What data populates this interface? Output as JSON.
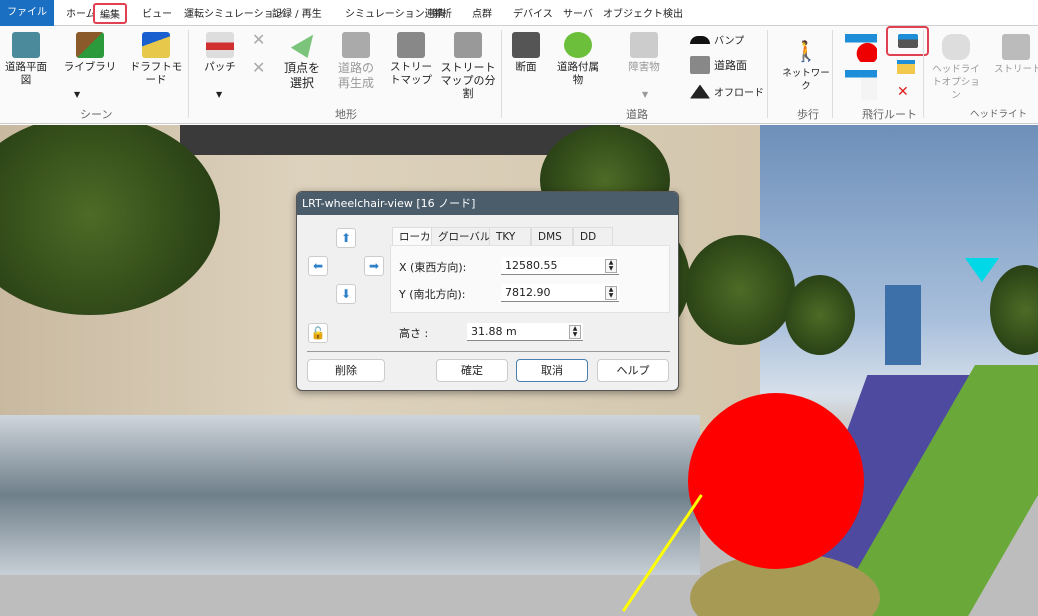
{
  "tabs": [
    "ファイル",
    "ホーム",
    "編集",
    "ビュー",
    "運転シミュレーション",
    "記録 / 再生",
    "シミュレーション連携",
    "解析",
    "点群",
    "デバイス",
    "サーバ",
    "オブジェクト検出"
  ],
  "active_tab": "編集",
  "ribbon": {
    "scene": {
      "label": "シーン",
      "road_plan": "道路平面図",
      "library": "ライブラリ",
      "draft_mode": "ドラフトモード"
    },
    "terrain": {
      "label": "地形",
      "patch": "パッチ",
      "select_vertex": "頂点を選択",
      "regen_road": "道路の再生成",
      "street_map": "ストリートマップ",
      "split_street_map": "ストリートマップの分割"
    },
    "road": {
      "label": "道路",
      "section": "断面",
      "road_furniture": "道路付属物",
      "obstacle": "障害物",
      "bump": "バンプ",
      "road_surface": "道路面",
      "offroad": "オフロード"
    },
    "walk": {
      "label": "歩行",
      "network": "ネットワーク"
    },
    "flight": {
      "label": "飛行ルート"
    },
    "headlight": {
      "label": "ヘッドライト",
      "options": "ヘッドライトオプション",
      "street": "ストリートラ"
    }
  },
  "dialog": {
    "title": "LRT-wheelchair-view [16 ノード]",
    "tabs": [
      "ローカル",
      "グローバル",
      "TKY",
      "DMS",
      "DD"
    ],
    "x_label": "X (東西方向):",
    "x_value": "12580.55",
    "y_label": "Y (南北方向):",
    "y_value": "7812.90",
    "height_label": "高さ :",
    "height_value": "31.88 m",
    "buttons": {
      "delete": "削除",
      "ok": "確定",
      "cancel": "取消",
      "help": "ヘルプ"
    }
  },
  "colors": {
    "accent": "#1b6fc2",
    "highlight": "#e04050",
    "title_bar": "#4b5d6b"
  }
}
